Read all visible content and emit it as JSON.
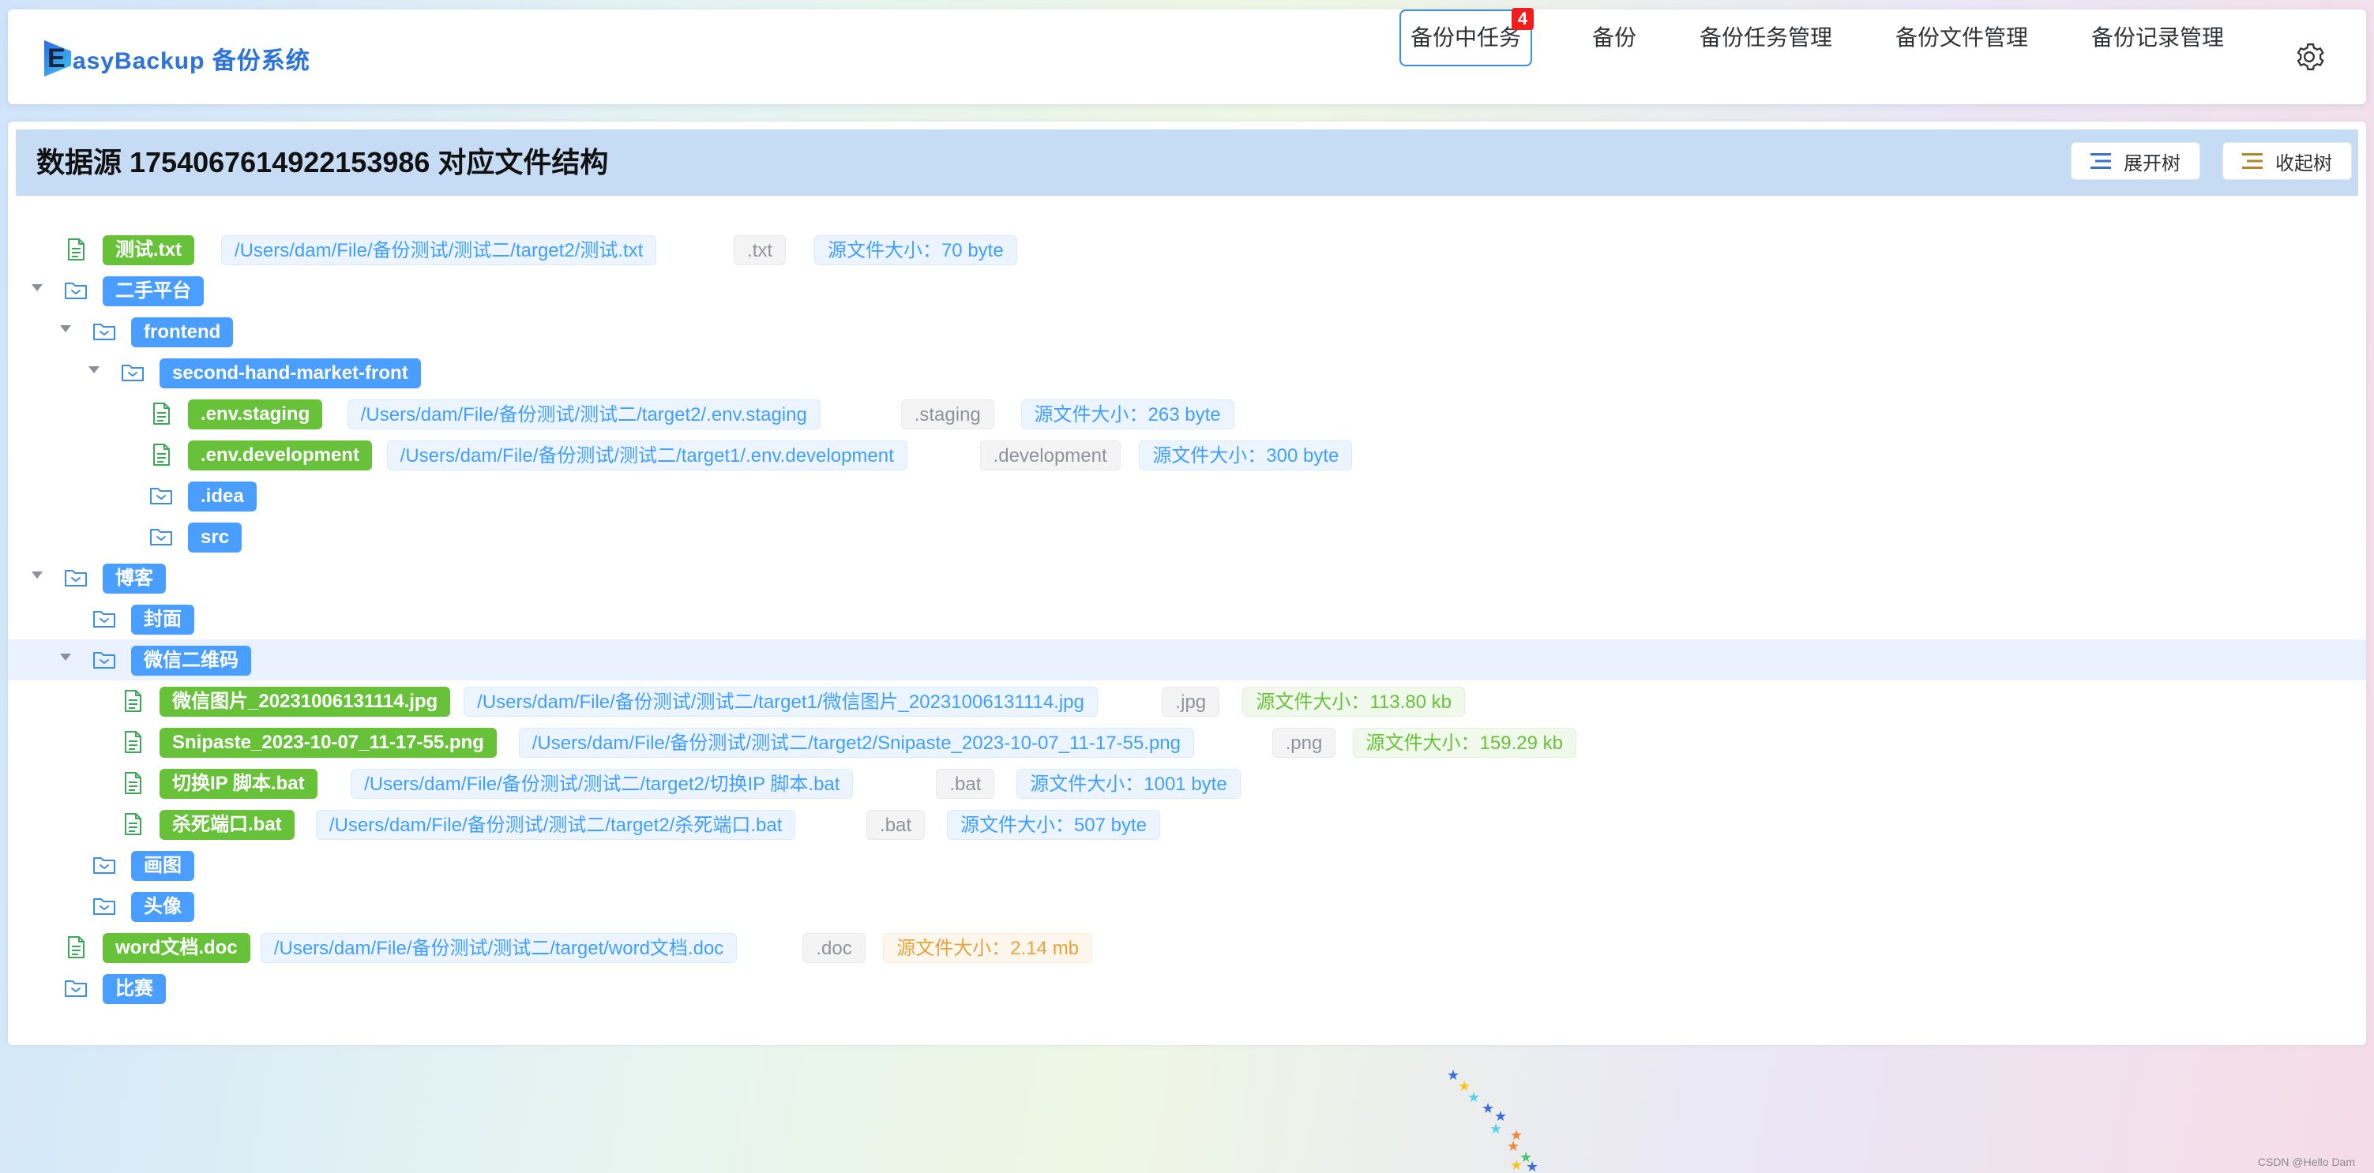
{
  "header": {
    "logo_letter": "E",
    "logo_text": "asyBackup 备份系统",
    "nav": [
      {
        "label": "备份中任务",
        "badge": "4"
      },
      {
        "label": "备份"
      },
      {
        "label": "备份任务管理"
      },
      {
        "label": "备份文件管理"
      },
      {
        "label": "备份记录管理"
      }
    ],
    "settings_icon": "gear-icon"
  },
  "panel": {
    "title": "数据源 1754067614922153986 对应文件结构",
    "expand_label": "展开树",
    "collapse_label": "收起树"
  },
  "colors": {
    "folder_tag": "#4a9eff",
    "file_tag": "#67c23a",
    "highlight_row": "#eaf2ff"
  },
  "tree": [
    {
      "type": "file",
      "depth": 0,
      "name": "测试.txt",
      "path": "/Users/dam/File/备份测试/测试二/target2/测试.txt",
      "ext": ".txt",
      "size": "源文件大小：70 byte",
      "size_unit": "b"
    },
    {
      "type": "folder",
      "depth": 0,
      "expanded": true,
      "name": "二手平台"
    },
    {
      "type": "folder",
      "depth": 1,
      "expanded": true,
      "name": "frontend"
    },
    {
      "type": "folder",
      "depth": 2,
      "expanded": true,
      "name": "second-hand-market-front"
    },
    {
      "type": "file",
      "depth": 3,
      "name": ".env.staging",
      "path": "/Users/dam/File/备份测试/测试二/target2/.env.staging",
      "ext": ".staging",
      "size": "源文件大小：263 byte",
      "size_unit": "b"
    },
    {
      "type": "file",
      "depth": 3,
      "name": ".env.development",
      "path": "/Users/dam/File/备份测试/测试二/target1/.env.development",
      "ext": ".development",
      "size": "源文件大小：300 byte",
      "size_unit": "b"
    },
    {
      "type": "folder",
      "depth": 3,
      "expanded": false,
      "leaf": true,
      "name": ".idea"
    },
    {
      "type": "folder",
      "depth": 3,
      "expanded": false,
      "leaf": true,
      "name": "src"
    },
    {
      "type": "folder",
      "depth": 0,
      "expanded": true,
      "name": "博客"
    },
    {
      "type": "folder",
      "depth": 1,
      "expanded": false,
      "leaf": true,
      "name": "封面"
    },
    {
      "type": "folder",
      "depth": 1,
      "expanded": true,
      "name": "微信二维码",
      "highlight": true
    },
    {
      "type": "file",
      "depth": 2,
      "name": "微信图片_20231006131114.jpg",
      "path": "/Users/dam/File/备份测试/测试二/target1/微信图片_20231006131114.jpg",
      "ext": ".jpg",
      "size": "源文件大小：113.80 kb",
      "size_unit": "kb"
    },
    {
      "type": "file",
      "depth": 2,
      "name": "Snipaste_2023-10-07_11-17-55.png",
      "path": "/Users/dam/File/备份测试/测试二/target2/Snipaste_2023-10-07_11-17-55.png",
      "ext": ".png",
      "size": "源文件大小：159.29 kb",
      "size_unit": "kb"
    },
    {
      "type": "file",
      "depth": 2,
      "name": "切换IP 脚本.bat",
      "path": "/Users/dam/File/备份测试/测试二/target2/切换IP 脚本.bat",
      "ext": ".bat",
      "size": "源文件大小：1001 byte",
      "size_unit": "b"
    },
    {
      "type": "file",
      "depth": 2,
      "name": "杀死端口.bat",
      "path": "/Users/dam/File/备份测试/测试二/target2/杀死端口.bat",
      "ext": ".bat",
      "size": "源文件大小：507 byte",
      "size_unit": "b"
    },
    {
      "type": "folder",
      "depth": 1,
      "expanded": false,
      "leaf": true,
      "name": "画图"
    },
    {
      "type": "folder",
      "depth": 1,
      "expanded": false,
      "leaf": true,
      "name": "头像"
    },
    {
      "type": "file",
      "depth": 0,
      "name": "word文档.doc",
      "path": "/Users/dam/File/备份测试/测试二/target/word文档.doc",
      "ext": ".doc",
      "size": "源文件大小：2.14 mb",
      "size_unit": "mb"
    },
    {
      "type": "folder",
      "depth": 0,
      "expanded": false,
      "leaf": true,
      "name": "比赛"
    }
  ],
  "credit": "CSDN @Hello Dam"
}
